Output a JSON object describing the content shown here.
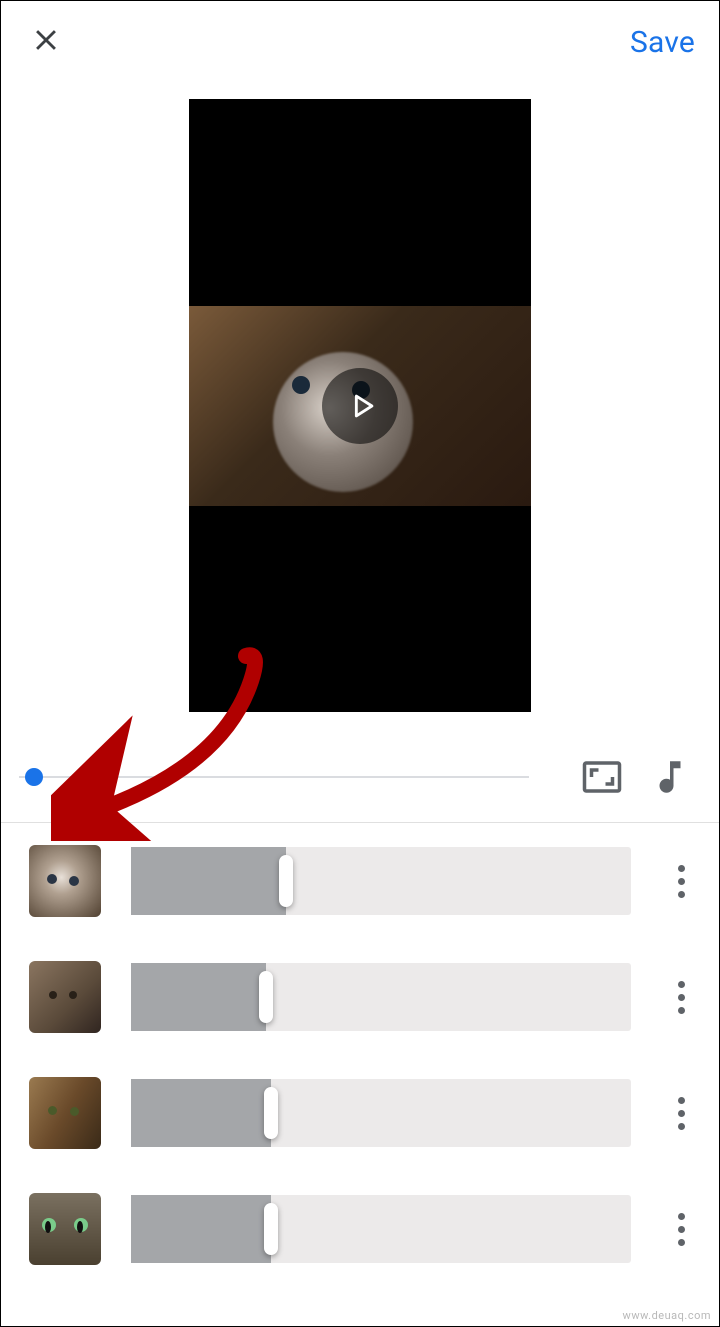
{
  "header": {
    "save_label": "Save"
  },
  "controls": {
    "aspect_icon": "aspect-ratio-icon",
    "music_icon": "music-note-icon"
  },
  "clips": [
    {
      "fill_percent": 31
    },
    {
      "fill_percent": 27
    },
    {
      "fill_percent": 28
    },
    {
      "fill_percent": 28
    }
  ],
  "watermark": "www.deuaq.com"
}
